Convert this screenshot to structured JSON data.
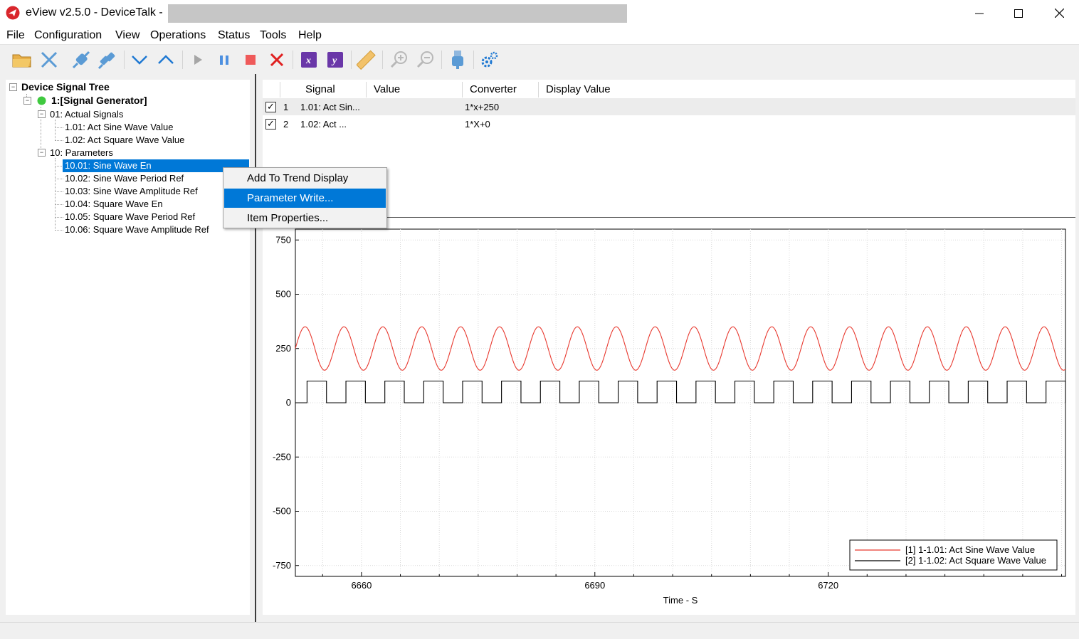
{
  "window": {
    "title": "eView v2.5.0 - DeviceTalk  -"
  },
  "menu": [
    "File",
    "Configuration",
    "View",
    "Operations",
    "Status",
    "Tools",
    "Help"
  ],
  "toolbar": {
    "icons": [
      "folder-open-icon",
      "disconnect-icon",
      "connect-icon",
      "plug-icon",
      "arrow-down-icon",
      "arrow-up-icon",
      "play-icon",
      "pause-icon",
      "stop-icon",
      "delete-icon",
      "x-axis-icon",
      "y-axis-icon",
      "ruler-icon",
      "zoom-in-icon",
      "zoom-out-icon",
      "usb-icon",
      "settings-icon"
    ],
    "x_label": "x",
    "y_label": "y"
  },
  "tree": {
    "root": "Device Signal Tree",
    "device": "1:[Signal Generator]",
    "groups": [
      {
        "label": "01: Actual Signals",
        "items": [
          "1.01: Act Sine Wave Value",
          "1.02: Act Square Wave Value"
        ]
      },
      {
        "label": "10: Parameters",
        "items": [
          "10.01: Sine Wave En",
          "10.02: Sine Wave Period Ref",
          "10.03: Sine Wave Amplitude Ref",
          "10.04: Square Wave En",
          "10.05: Square Wave Period Ref",
          "10.06: Square Wave Amplitude Ref"
        ]
      }
    ],
    "device_status_color": "#3fc93f"
  },
  "context_menu": {
    "items": [
      "Add To Trend Display",
      "Parameter Write...",
      "Item Properties..."
    ],
    "highlighted": "Parameter Write..."
  },
  "signal_table": {
    "columns": [
      "Signal",
      "Value",
      "Converter",
      "Display Value"
    ],
    "rows": [
      {
        "checked": true,
        "index": "1",
        "signal": "1.01: Act Sin...",
        "value": "",
        "converter": "1*x+250",
        "display": ""
      },
      {
        "checked": true,
        "index": "2",
        "signal": "1.02: Act ...",
        "value": "",
        "converter": "1*X+0",
        "display": ""
      }
    ]
  },
  "chart_data": {
    "type": "line",
    "xlabel": "Time - S",
    "ylabel": "",
    "xlim": [
      6651.5,
      6750.5
    ],
    "ylim": [
      -800,
      800
    ],
    "x_ticks": [
      6660,
      6690,
      6720
    ],
    "y_ticks": [
      750,
      500,
      250,
      0,
      -250,
      -500,
      -750
    ],
    "grid": true,
    "legend_position": "bottom-right",
    "series": [
      {
        "name": "[1] 1-1.01: Act Sine Wave Value",
        "color": "#e8392f",
        "kind": "sine",
        "offset": 250,
        "amplitude": 100,
        "period_s": 5,
        "phase_start_x": 6651.5
      },
      {
        "name": "[2] 1-1.02: Act Square Wave Value",
        "color": "#000000",
        "kind": "square",
        "low": 0,
        "high": 100,
        "period_s": 5,
        "high_duration_s": 2.5,
        "first_rise_x": 6653.0
      }
    ]
  }
}
